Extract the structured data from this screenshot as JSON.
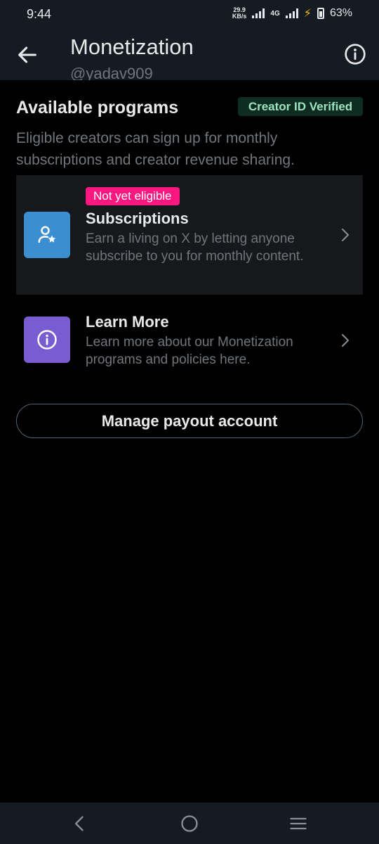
{
  "status_bar": {
    "time": "9:44",
    "net_speed_value": "29.9",
    "net_speed_unit": "KB/s",
    "network": "4G",
    "battery": "63%"
  },
  "header": {
    "title": "Monetization",
    "handle": "@yadav909"
  },
  "available": {
    "title": "Available programs",
    "badge": "Creator ID Verified",
    "description": "Eligible creators can sign up for monthly subscriptions and creator revenue sharing."
  },
  "programs": [
    {
      "badge": "Not yet eligible",
      "title": "Subscriptions",
      "description": "Earn a living on X by letting anyone subscribe to you for monthly content.",
      "icon": "subscriptions-icon",
      "icon_color": "#3b8fd1"
    },
    {
      "title": "Learn More",
      "description": "Learn more about our Monetization programs and policies here.",
      "icon": "info-icon",
      "icon_color": "#7a5cd1"
    }
  ],
  "payout_button": "Manage payout account",
  "colors": {
    "background": "#000000",
    "header_bg": "#151b22",
    "verified_bg": "#0f2c22",
    "verified_text": "#9de3c0",
    "pink": "#f91880",
    "muted_text": "#71767b"
  }
}
